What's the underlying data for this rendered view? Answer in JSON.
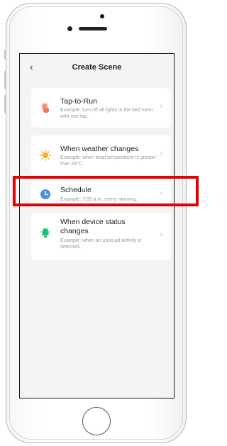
{
  "header": {
    "back_icon": "‹",
    "title": "Create Scene"
  },
  "options": [
    {
      "title": "Tap-to-Run",
      "description": "Example: turn off all lights in the bed room with one tap.",
      "icon": "tap-icon",
      "color": "#f2795c"
    },
    {
      "title": "When weather changes",
      "description": "Example: when local temperature is greater than 28°C.",
      "icon": "sun-icon",
      "color": "#f6b11e"
    },
    {
      "title": "Schedule",
      "description": "Example: 7:00 a.m. every morning.",
      "icon": "clock-icon",
      "color": "#4a90e2"
    },
    {
      "title": "When device status changes",
      "description": "Example: when an unusual activity is detected.",
      "icon": "device-icon",
      "color": "#1ec27a"
    }
  ],
  "chevron": "›"
}
